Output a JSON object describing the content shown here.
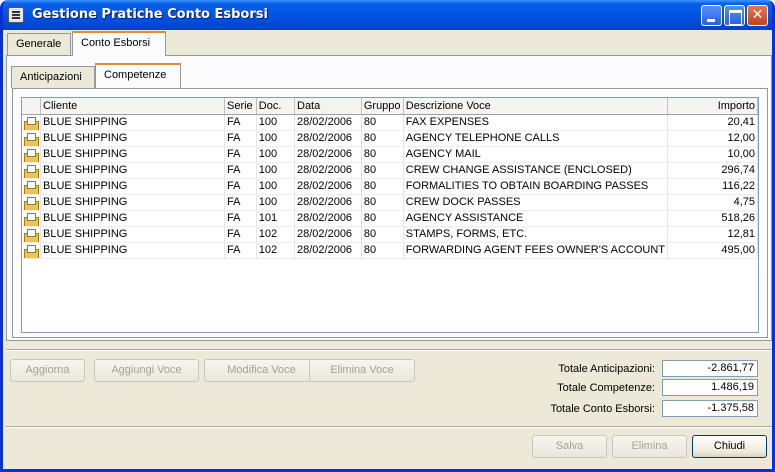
{
  "window": {
    "title": "Gestione Pratiche Conto Esborsi"
  },
  "tabs": {
    "outer": [
      "Generale",
      "Conto Esborsi"
    ],
    "inner": [
      "Anticipazioni",
      "Competenze"
    ]
  },
  "grid": {
    "columns": [
      "Cliente",
      "Serie",
      "Doc.",
      "Data",
      "Gruppo",
      "Descrizione Voce",
      "Importo"
    ],
    "rows": [
      [
        "BLUE SHIPPING",
        "FA",
        "100",
        "28/02/2006",
        "80",
        "FAX EXPENSES",
        "20,41"
      ],
      [
        "BLUE SHIPPING",
        "FA",
        "100",
        "28/02/2006",
        "80",
        "AGENCY TELEPHONE CALLS",
        "12,00"
      ],
      [
        "BLUE SHIPPING",
        "FA",
        "100",
        "28/02/2006",
        "80",
        "AGENCY MAIL",
        "10,00"
      ],
      [
        "BLUE SHIPPING",
        "FA",
        "100",
        "28/02/2006",
        "80",
        "CREW CHANGE ASSISTANCE (ENCLOSED)",
        "296,74"
      ],
      [
        "BLUE SHIPPING",
        "FA",
        "100",
        "28/02/2006",
        "80",
        "FORMALITIES TO OBTAIN BOARDING PASSES",
        "116,22"
      ],
      [
        "BLUE SHIPPING",
        "FA",
        "100",
        "28/02/2006",
        "80",
        "CREW DOCK PASSES",
        "4,75"
      ],
      [
        "BLUE SHIPPING",
        "FA",
        "101",
        "28/02/2006",
        "80",
        "AGENCY ASSISTANCE",
        "518,26"
      ],
      [
        "BLUE SHIPPING",
        "FA",
        "102",
        "28/02/2006",
        "80",
        "STAMPS, FORMS, ETC.",
        "12,81"
      ],
      [
        "BLUE SHIPPING",
        "FA",
        "102",
        "28/02/2006",
        "80",
        "FORWARDING AGENT FEES OWNER'S ACCOUNT",
        "495,00"
      ]
    ]
  },
  "actions": {
    "aggiorna": "Aggiorna",
    "aggiungi": "Aggiungi Voce",
    "modifica": "Modifica Voce",
    "elimina_voce": "Elimina Voce"
  },
  "totals": [
    {
      "label": "Totale Anticipazioni:",
      "value": "-2.861,77"
    },
    {
      "label": "Totale Competenze:",
      "value": "1.486,19"
    },
    {
      "label": "Totale Conto Esborsi:",
      "value": "-1.375,58"
    }
  ],
  "footer": {
    "salva": "Salva",
    "elimina": "Elimina",
    "chiudi": "Chiudi"
  }
}
